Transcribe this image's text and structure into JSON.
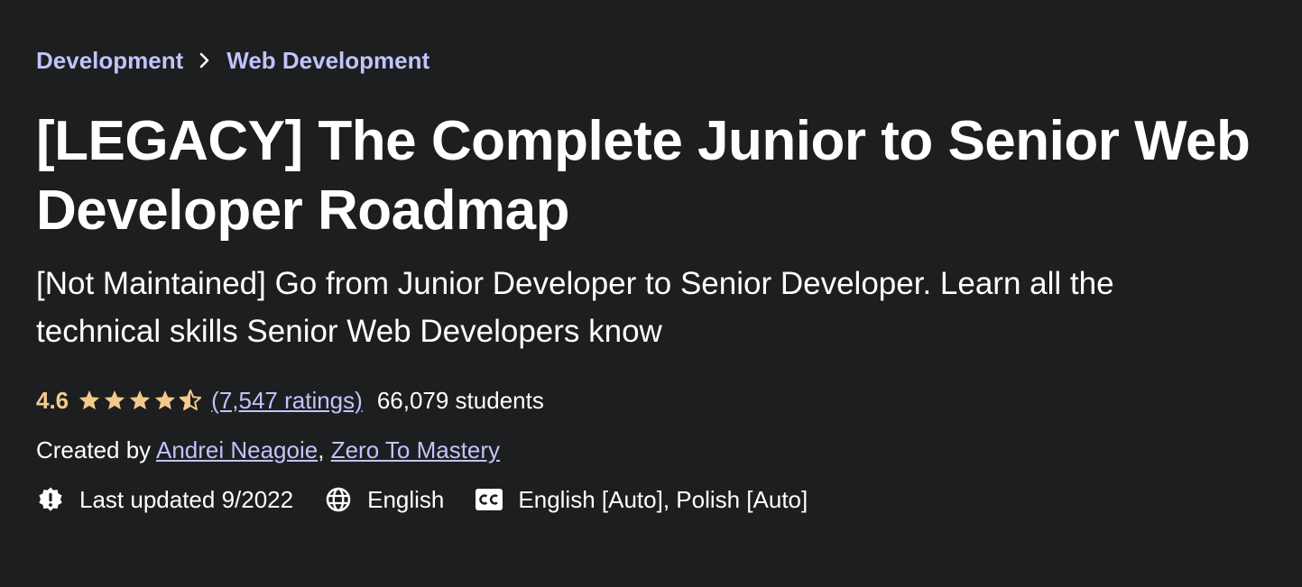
{
  "breadcrumb": {
    "items": [
      "Development",
      "Web Development"
    ],
    "separator_icon": "chevron-right-icon"
  },
  "course": {
    "title": "[LEGACY] The Complete Junior to Senior Web Developer Roadmap",
    "subtitle": "[Not Maintained] Go from Junior Developer to Senior Developer. Learn all the technical skills Senior Web Developers know"
  },
  "rating": {
    "value": "4.6",
    "stars": 4.6,
    "stars_max": 5,
    "ratings_count_text": "(7,547 ratings)",
    "students_text": "66,079 students"
  },
  "creators": {
    "prefix": "Created by",
    "names": [
      "Andrei Neagoie",
      "Zero To Mastery"
    ],
    "separator": ","
  },
  "meta": {
    "last_updated": "Last updated 9/2022",
    "language": "English",
    "captions": "English [Auto], Polish [Auto]"
  },
  "colors": {
    "background": "#1d1e20",
    "link": "#c0c4fc",
    "rating": "#f3ca8c",
    "text": "#ffffff"
  }
}
